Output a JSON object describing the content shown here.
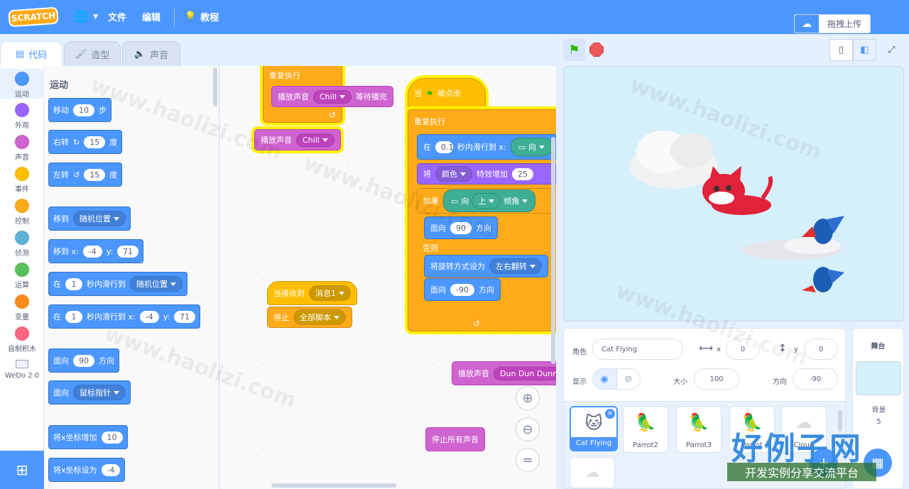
{
  "menubar": {
    "logo": "SCRATCH",
    "file": "文件",
    "edit": "编辑",
    "tutorials": "教程",
    "upload": "拖拽上传"
  },
  "tabs": {
    "code": "代码",
    "costumes": "造型",
    "sounds": "声音"
  },
  "categories": [
    {
      "label": "运动",
      "color": "#4c97ff"
    },
    {
      "label": "外观",
      "color": "#9966ff"
    },
    {
      "label": "声音",
      "color": "#cf63cf"
    },
    {
      "label": "事件",
      "color": "#ffbf00"
    },
    {
      "label": "控制",
      "color": "#ffab19"
    },
    {
      "label": "侦测",
      "color": "#5cb1d6"
    },
    {
      "label": "运算",
      "color": "#59c059"
    },
    {
      "label": "变量",
      "color": "#ff8c1a"
    },
    {
      "label": "自制积木",
      "color": "#ff6680"
    },
    {
      "label": "WeDo 2.0",
      "color": "#ffffff"
    }
  ],
  "palette": {
    "title": "运动",
    "move": {
      "a": "移动",
      "v": "10",
      "b": "步"
    },
    "turn_right": {
      "a": "右转",
      "v": "15",
      "b": "度"
    },
    "turn_left": {
      "a": "左转",
      "v": "15",
      "b": "度"
    },
    "goto": {
      "a": "移到",
      "dd": "随机位置"
    },
    "goto_xy": {
      "a": "移到 x:",
      "x": "-4",
      "y_lbl": "y:",
      "y": "71"
    },
    "glide": {
      "a": "在",
      "v": "1",
      "b": "秒内滑行到",
      "dd": "随机位置"
    },
    "glide_xy": {
      "a": "在",
      "v": "1",
      "b": "秒内滑行到 x:",
      "x": "-4",
      "y_lbl": "y:",
      "y": "71"
    },
    "point": {
      "a": "面向",
      "v": "90",
      "b": "方向"
    },
    "point_towards": {
      "a": "面向",
      "dd": "鼠标指针"
    },
    "change_x": {
      "a": "将x坐标增加",
      "v": "10"
    },
    "set_x": {
      "a": "将x坐标设为",
      "v": "-4"
    }
  },
  "workspace": {
    "repeat1": "重复执行",
    "play_until": {
      "a": "播放声音",
      "dd": "Chill",
      "b": "等待播完"
    },
    "play": {
      "a": "播放声音",
      "dd": "Chill"
    },
    "recv": {
      "a": "当接收到",
      "dd": "消息1"
    },
    "stop": {
      "a": "停止",
      "dd": "全部脚本"
    },
    "flag_hat": {
      "a": "当",
      "b": "被点击"
    },
    "repeat2": "重复执行",
    "glide": {
      "a": "在",
      "v": "0.1",
      "b": "秒内滑行到 x:",
      "c": "向"
    },
    "effect": {
      "a": "将",
      "dd": "颜色",
      "b": "特效增加",
      "v": "25"
    },
    "if": {
      "a": "如果",
      "dd": "上",
      "b": "向",
      "c": "倾角"
    },
    "point1": {
      "a": "面向",
      "v": "90",
      "b": "方向"
    },
    "else": "否则",
    "rotation": {
      "a": "将旋转方式设为",
      "dd": "左右翻转"
    },
    "point2": {
      "a": "面向",
      "v": "-90",
      "b": "方向"
    },
    "play2": {
      "a": "播放声音",
      "dd": "Dun Dun Dunnn"
    },
    "stop_sounds": "停止所有声音"
  },
  "sprite_info": {
    "sprite_label": "角色",
    "sprite_name": "Cat Flying",
    "x_label": "x",
    "x": "0",
    "y_label": "y",
    "y": "0",
    "show_label": "显示",
    "size_label": "大小",
    "size": "100",
    "dir_label": "方向",
    "direction": "-90"
  },
  "sprites": [
    "Cat Flying",
    "Parrot2",
    "Parrot3",
    "Parrot",
    "Cloud"
  ],
  "stage_panel": {
    "title": "舞台",
    "backdrop_label": "背景",
    "backdrop_count": "5"
  },
  "watermark": {
    "site": "www.haolizi.com",
    "brand": "好例子网",
    "tagline": "开发实例分享交流平台"
  }
}
